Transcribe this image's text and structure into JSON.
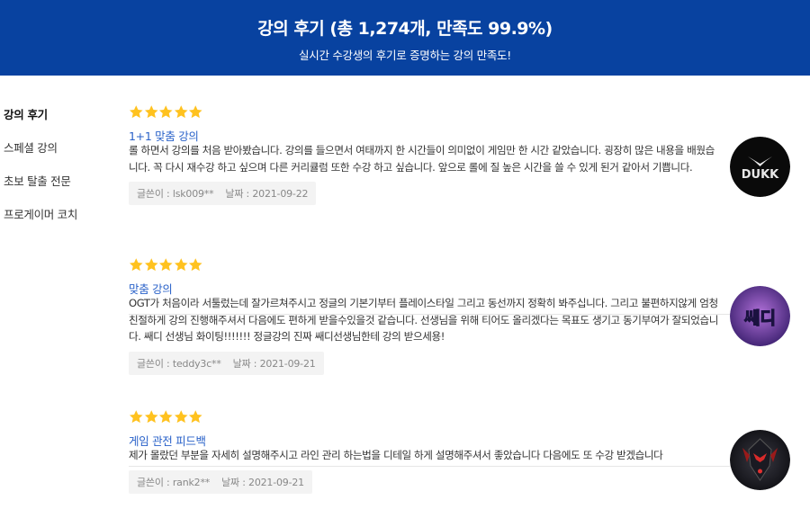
{
  "header": {
    "title": "강의 후기 (총 1,274개, 만족도 99.9%)",
    "subtitle": "실시간 수강생의 후기로 증명하는 강의 만족도!",
    "background": "#0842a0"
  },
  "sidebar": {
    "items": [
      {
        "label": "강의 후기",
        "active": true
      },
      {
        "label": "스페셜 강의",
        "active": false
      },
      {
        "label": "초보 탈출 전문",
        "active": false
      },
      {
        "label": "프로게이머 코치",
        "active": false
      }
    ]
  },
  "reviews": [
    {
      "rating": 5,
      "title": "1+1 맞춤 강의",
      "body": "롤 하면서 강의를 처음 받아봤습니다. 강의를 들으면서 여태까지 한 시간들이 의미없이 게임만 한 시간 같았습니다. 굉장히 많은 내용을 배웠습니다. 꼭 다시 재수강 하고 싶으며 다른 커리큘럼 또한 수강 하고 싶습니다. 앞으로 롤에 질 높은 시간을 쓸 수 있게 된거 같아서 기쁩니다.",
      "author_label": "글쓴이 : lsk009**",
      "date_label": "날짜 : 2021-09-22",
      "avatar_icon": "dukk-logo",
      "avatar_text": "DUKK"
    },
    {
      "rating": 5,
      "title": "맞춤 강의",
      "body": "OGT가 처음이라 서툴렀는데 잘가르쳐주시고 정글의 기본기부터 플레이스타일 그리고 동선까지 정확히 봐주십니다. 그리고 불편하지않게 엄청 친절하게 강의 진행해주셔서 다음에도 편하게 받을수있을것 같습니다. 선생님을 위해 티어도 올리겠다는 목표도 생기고 동기부여가 잘되었습니다. 쌔디 선생님 화이팅!!!!!!! 정글강의 진짜 쌔디선생님한테 강의 받으세용!",
      "author_label": "글쓴이 : teddy3c**",
      "date_label": "날짜 : 2021-09-21",
      "avatar_icon": "ssaedi-logo",
      "avatar_text": "쌔디"
    },
    {
      "rating": 5,
      "title": "게임 관전 피드백",
      "body": "제가 몰랐던 부분을 자세히 설명해주시고 라인 관리 하는법을 디테일 하게 설명해주셔서 좋았습니다 다음에도 또 수강 받겠습니다",
      "author_label": "글쓴이 : rank2**",
      "date_label": "날짜 : 2021-09-21",
      "avatar_icon": "armored-champion-avatar",
      "avatar_text": ""
    }
  ],
  "colors": {
    "star": "#ffc21f",
    "review_title": "#2a62c9",
    "meta_bg": "#f3f3f3"
  }
}
